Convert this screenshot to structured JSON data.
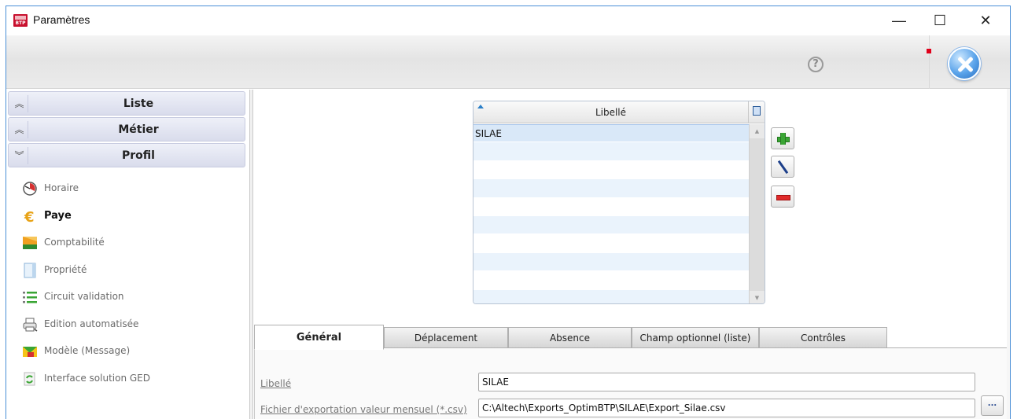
{
  "window": {
    "title": "Paramètres",
    "app_badge": "BTP",
    "minimize": "—",
    "maximize": "☐",
    "close": "✕"
  },
  "toolbar": {
    "help": "?"
  },
  "sidebar": {
    "sections": [
      {
        "label": "Liste",
        "chevron": "≈"
      },
      {
        "label": "Métier",
        "chevron": "≈"
      },
      {
        "label": "Profil",
        "chevron": "≈"
      }
    ],
    "items": [
      {
        "label": "Horaire",
        "icon": "clock-icon"
      },
      {
        "label": "Paye",
        "icon": "euro-icon",
        "active": true
      },
      {
        "label": "Comptabilité",
        "icon": "ledger-icon"
      },
      {
        "label": "Propriété",
        "icon": "document-icon"
      },
      {
        "label": "Circuit validation",
        "icon": "checklist-icon"
      },
      {
        "label": "Edition automatisée",
        "icon": "printer-icon"
      },
      {
        "label": "Modèle (Message)",
        "icon": "envelope-icon"
      },
      {
        "label": "Interface solution GED",
        "icon": "sync-icon"
      }
    ]
  },
  "grid": {
    "column_header": "Libellé",
    "rows": [
      "SILAE"
    ]
  },
  "tabs": [
    {
      "label": "Général",
      "active": true
    },
    {
      "label": "Déplacement"
    },
    {
      "label": "Absence"
    },
    {
      "label": "Champ optionnel (liste)"
    },
    {
      "label": "Contrôles"
    }
  ],
  "form": {
    "libelle_label": "Libellé",
    "libelle_value": "SILAE",
    "fichier_label": "Fichier d'exportation valeur mensuel (*.csv)",
    "fichier_value": "C:\\Altech\\Exports_OptimBTP\\SILAE\\Export_Silae.csv",
    "browse_label": "..."
  },
  "colors": {
    "accent": "#2b7fc8",
    "add": "#3aa534",
    "delete": "#e02a2a",
    "row_alt": "#eaf3fc"
  }
}
